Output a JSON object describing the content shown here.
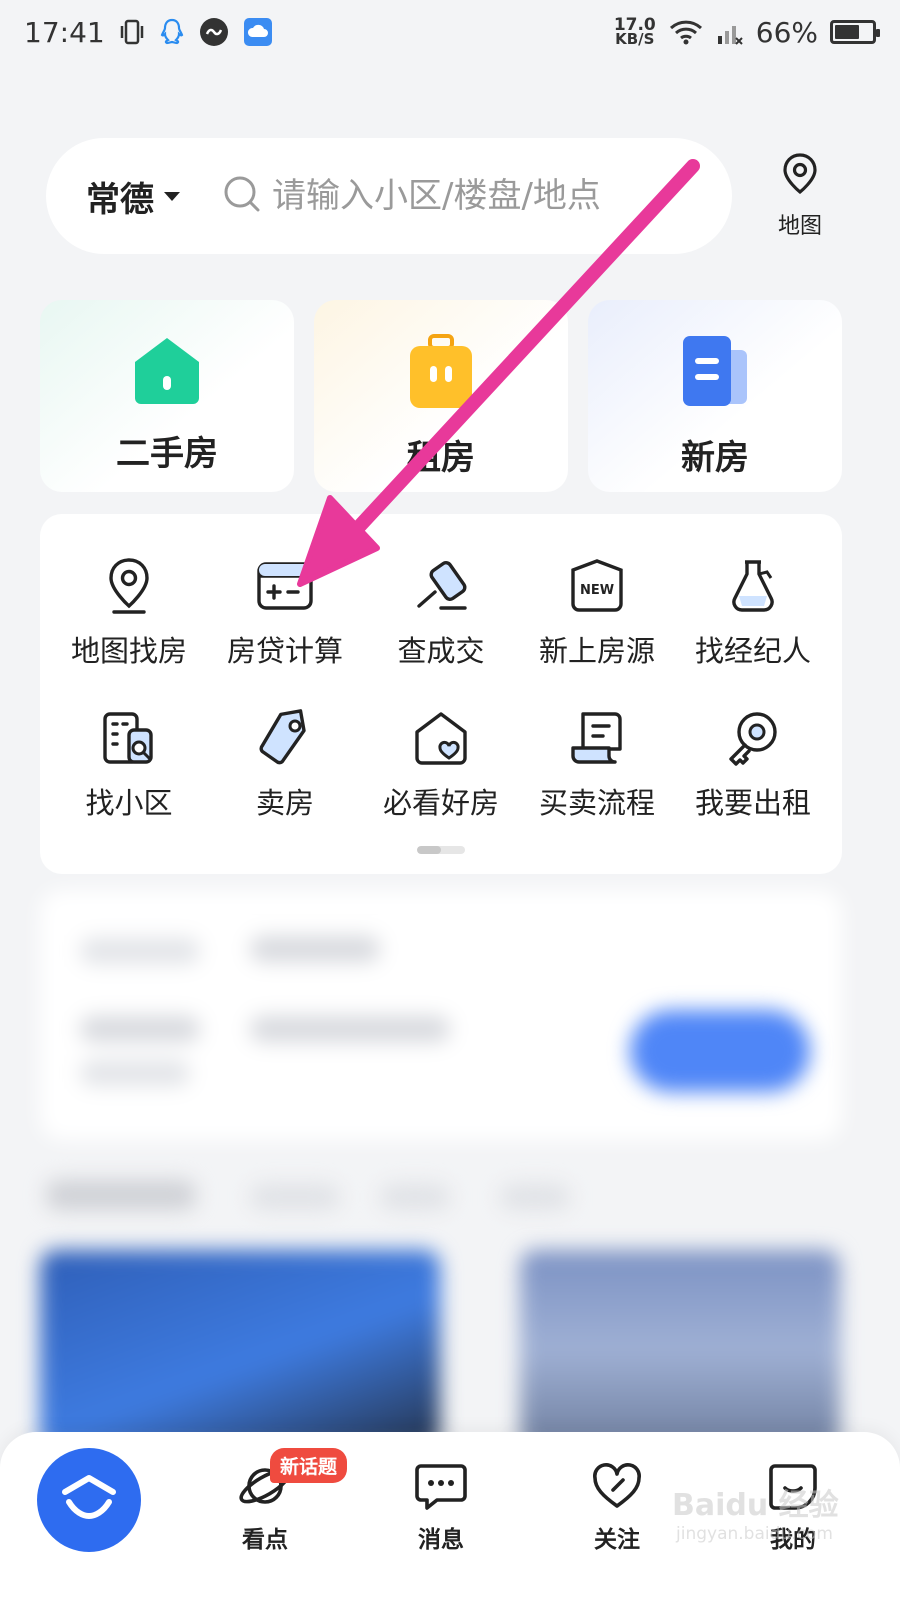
{
  "status_bar": {
    "time": "17:41",
    "net_speed_value": "17.0",
    "net_speed_unit": "KB/S",
    "battery": "66%",
    "battery_level": 0.66
  },
  "search": {
    "city": "常德",
    "placeholder": "请输入小区/楼盘/地点",
    "map_label": "地图"
  },
  "cards": [
    {
      "label": "二手房",
      "icon": "house-icon",
      "color": "#1fcf9a"
    },
    {
      "label": "租房",
      "icon": "suitcase-icon",
      "color": "#ffb51e"
    },
    {
      "label": "新房",
      "icon": "building-icon",
      "color": "#3f78f0"
    }
  ],
  "tools": [
    {
      "label": "地图找房",
      "icon": "map-pin-icon"
    },
    {
      "label": "房贷计算",
      "icon": "calculator-icon"
    },
    {
      "label": "查成交",
      "icon": "gavel-icon"
    },
    {
      "label": "新上房源",
      "icon": "new-badge-icon"
    },
    {
      "label": "找经纪人",
      "icon": "agent-icon"
    },
    {
      "label": "找小区",
      "icon": "community-search-icon"
    },
    {
      "label": "卖房",
      "icon": "price-tag-icon"
    },
    {
      "label": "必看好房",
      "icon": "house-heart-icon"
    },
    {
      "label": "买卖流程",
      "icon": "document-icon"
    },
    {
      "label": "我要出租",
      "icon": "key-icon"
    }
  ],
  "new_badge_text": "NEW",
  "bottom_nav": {
    "items": [
      {
        "label": "看点",
        "icon": "planet-icon"
      },
      {
        "label": "消息",
        "icon": "chat-icon"
      },
      {
        "label": "关注",
        "icon": "heart-icon"
      },
      {
        "label": "我的",
        "icon": "profile-icon"
      }
    ],
    "badge": "新话题"
  },
  "watermark": {
    "main": "Baidu 经验",
    "sub": "jingyan.baidu.com"
  },
  "colors": {
    "accent": "#2e6cf0",
    "annotation": "#e8399a",
    "badge": "#ef4b3f"
  }
}
